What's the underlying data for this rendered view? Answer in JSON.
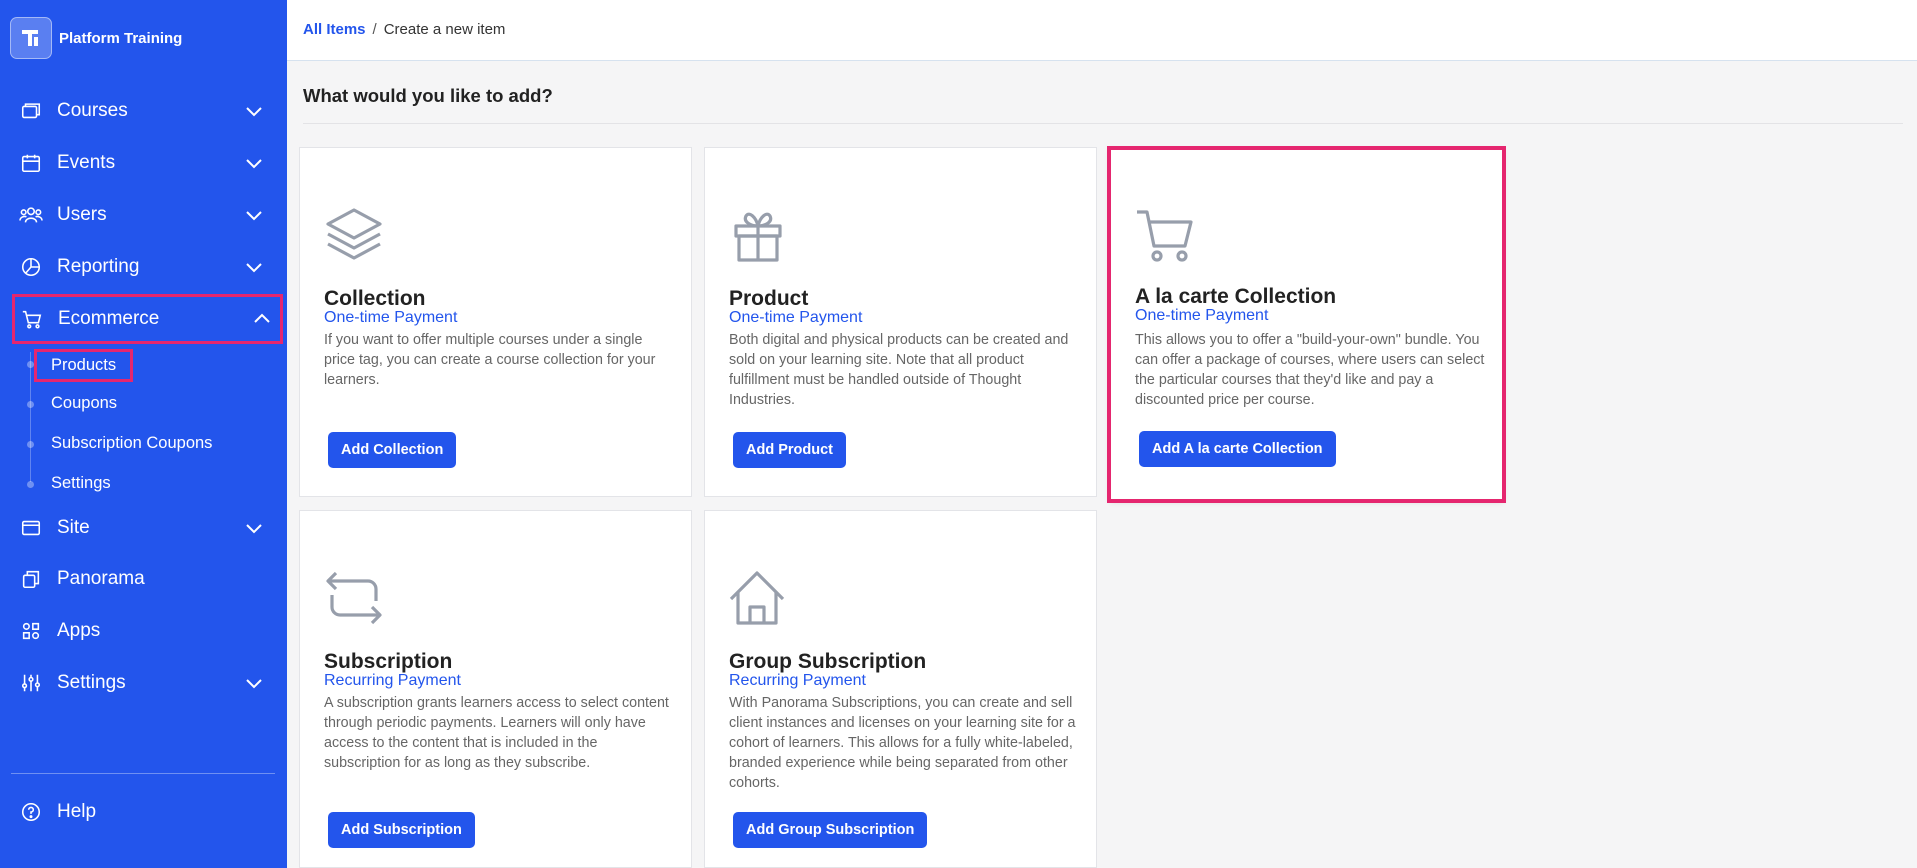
{
  "app": {
    "brand_name": "Platform Training"
  },
  "colors": {
    "sidebar": "#2355ec",
    "accent": "#2355ec",
    "highlight": "#e5266f"
  },
  "sidebar": {
    "items": [
      {
        "label": "Courses",
        "icon": "courses-icon",
        "expandable": true
      },
      {
        "label": "Events",
        "icon": "calendar-icon",
        "expandable": true
      },
      {
        "label": "Users",
        "icon": "users-icon",
        "expandable": true
      },
      {
        "label": "Reporting",
        "icon": "pie-chart-icon",
        "expandable": true
      },
      {
        "label": "Ecommerce",
        "icon": "cart-icon",
        "expandable": true,
        "expanded": true
      },
      {
        "label": "Site",
        "icon": "browser-icon",
        "expandable": true
      },
      {
        "label": "Panorama",
        "icon": "copy-icon",
        "expandable": false
      },
      {
        "label": "Apps",
        "icon": "apps-icon",
        "expandable": false
      },
      {
        "label": "Settings",
        "icon": "sliders-icon",
        "expandable": true
      }
    ],
    "ecommerce_sub": [
      "Products",
      "Coupons",
      "Subscription Coupons",
      "Settings"
    ],
    "help_label": "Help"
  },
  "breadcrumb": {
    "root": "All Items",
    "separator": "/",
    "current": "Create a new item"
  },
  "page": {
    "title": "What would you like to add?"
  },
  "cards": [
    {
      "title": "Collection",
      "subtitle": "One-time Payment",
      "description": "If you want to offer multiple courses under a single price tag, you can create a course collection for your learners.",
      "button": "Add Collection",
      "icon": "layers-icon"
    },
    {
      "title": "Product",
      "subtitle": "One-time Payment",
      "description": "Both digital and physical products can be created and sold on your learning site. Note that all product fulfillment must be handled outside of Thought Industries.",
      "button": "Add Product",
      "icon": "gift-icon"
    },
    {
      "title": "A la carte Collection",
      "subtitle": "One-time Payment",
      "description": "This allows you to offer a \"build-your-own\" bundle. You can offer a package of courses, where users can select the particular courses that they'd like and pay a discounted price per course.",
      "button": "Add A la carte Collection",
      "icon": "cart-icon"
    },
    {
      "title": "Subscription",
      "subtitle": "Recurring Payment",
      "description": "A subscription grants learners access to select content through periodic payments. Learners will only have access to the content that is included in the subscription for as long as they subscribe.",
      "button": "Add Subscription",
      "icon": "repeat-icon"
    },
    {
      "title": "Group Subscription",
      "subtitle": "Recurring Payment",
      "description": "With Panorama Subscriptions, you can create and sell client instances and licenses on your learning site for a cohort of learners. This allows for a fully white-labeled, branded experience while being separated from other cohorts.",
      "button": "Add Group Subscription",
      "icon": "home-icon"
    }
  ]
}
